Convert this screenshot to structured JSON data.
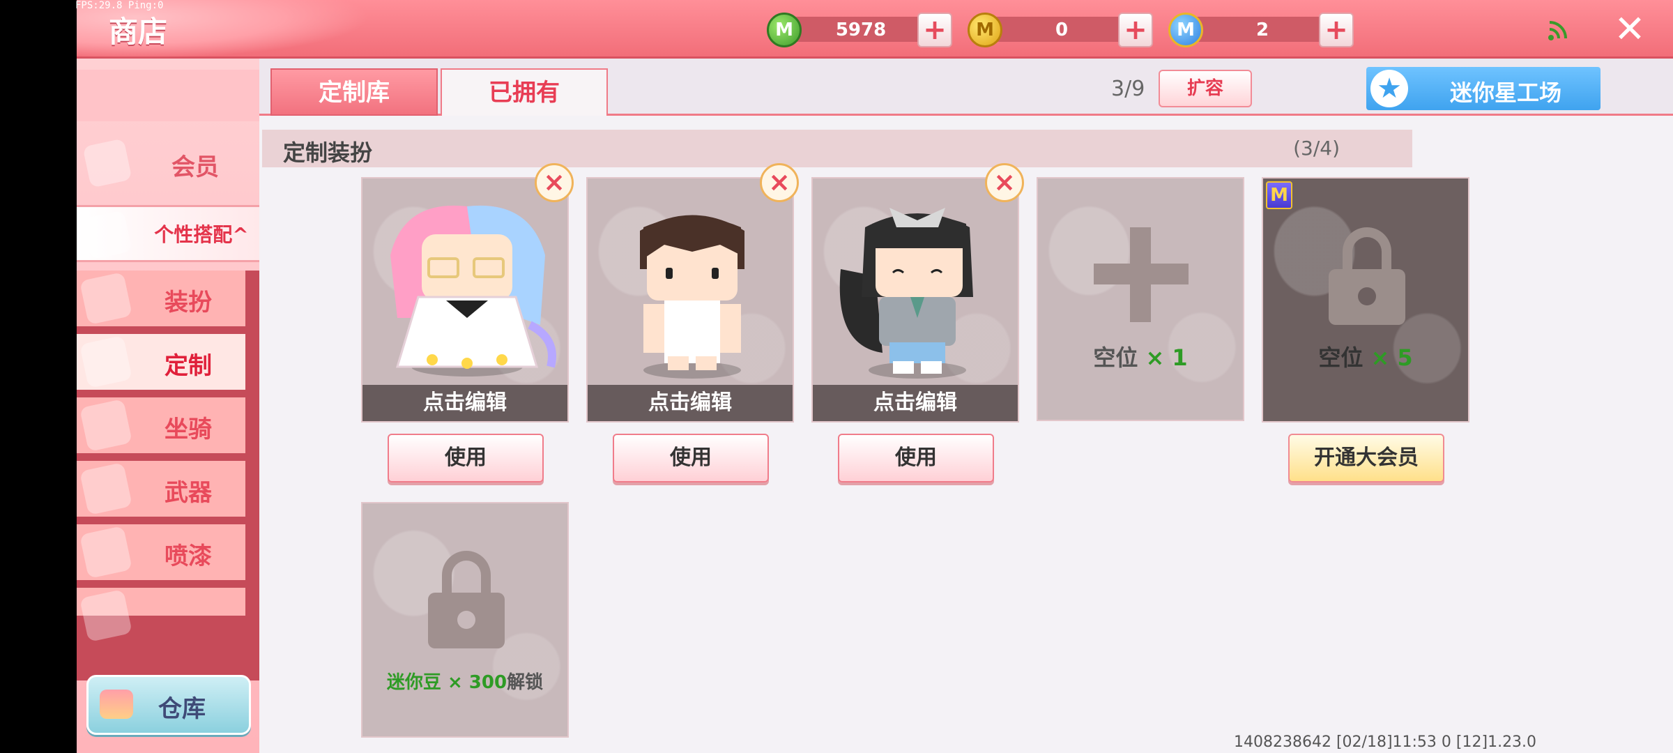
{
  "status": {
    "fps_text": "FPS:29.8 Ping:0"
  },
  "header": {
    "title": "商店",
    "currencies": [
      {
        "icon": "mini-coin-green-icon",
        "value": "5978"
      },
      {
        "icon": "mini-bean-gold-icon",
        "value": "0"
      },
      {
        "icon": "mini-point-blue-icon",
        "value": "2"
      }
    ],
    "plus_label": "+",
    "close_label": "✕"
  },
  "sidebar": {
    "member": "会员",
    "personal": "个性搭配",
    "personal_arrow": "^",
    "sub_items": [
      {
        "label": "装扮",
        "active": false
      },
      {
        "label": "定制",
        "active": true
      },
      {
        "label": "坐骑",
        "active": false
      },
      {
        "label": "武器",
        "active": false
      },
      {
        "label": "喷漆",
        "active": false
      }
    ],
    "storage": "仓库"
  },
  "tabs": {
    "library": "定制库",
    "owned": "已拥有"
  },
  "toolbar": {
    "capacity": "3/9",
    "expand": "扩容",
    "workshop": "迷你星工场"
  },
  "section": {
    "title": "定制装扮",
    "count": "(3/4)"
  },
  "cards": [
    {
      "edit": "点击编辑",
      "use": "使用"
    },
    {
      "edit": "点击编辑",
      "use": "使用"
    },
    {
      "edit": "点击编辑",
      "use": "使用"
    }
  ],
  "empty_slot": {
    "label": "空位",
    "mult": "× 1"
  },
  "vip_slot": {
    "label": "空位",
    "mult": "× 5",
    "button": "开通大会员",
    "badge": "M"
  },
  "locked_slot": {
    "prefix": "迷你豆 × 300",
    "suffix": "解锁"
  },
  "footer": {
    "info": "1408238642   [02/18]11:53 0    [12]1.23.0"
  },
  "colors": {
    "accent": "#f26e79",
    "green": "#2e9b25",
    "workshop": "#3fa3ef"
  }
}
